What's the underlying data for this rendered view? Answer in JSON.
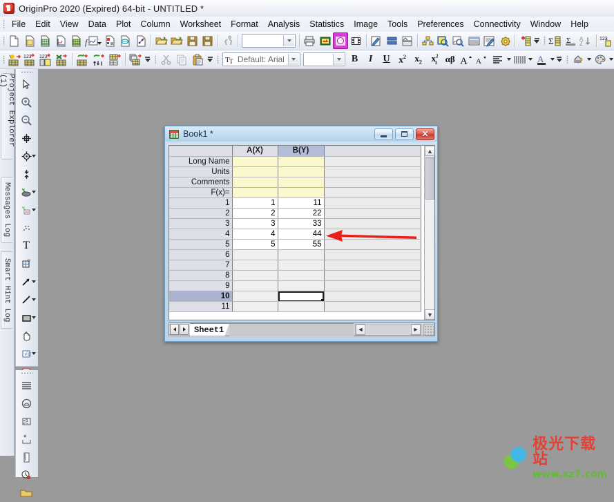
{
  "window": {
    "title": "OriginPro 2020 (Expired) 64-bit - UNTITLED *",
    "app_icon": "origin-app-icon"
  },
  "menubar": {
    "items": [
      {
        "label": "File"
      },
      {
        "label": "Edit"
      },
      {
        "label": "View"
      },
      {
        "label": "Data"
      },
      {
        "label": "Plot"
      },
      {
        "label": "Column"
      },
      {
        "label": "Worksheet"
      },
      {
        "label": "Format"
      },
      {
        "label": "Analysis"
      },
      {
        "label": "Statistics"
      },
      {
        "label": "Image"
      },
      {
        "label": "Tools"
      },
      {
        "label": "Preferences"
      },
      {
        "label": "Connectivity"
      },
      {
        "label": "Window"
      },
      {
        "label": "Help"
      }
    ]
  },
  "toolbar_standard": {
    "buttons": [
      {
        "name": "new-project-icon"
      },
      {
        "name": "new-folder-icon"
      },
      {
        "name": "new-workbook-icon"
      },
      {
        "name": "new-graph-icon"
      },
      {
        "name": "new-function-plot-icon"
      },
      {
        "name": "new-matrix-icon"
      },
      {
        "name": "new-layout-icon"
      },
      {
        "name": "new-notes-icon"
      },
      {
        "name": "open-project-icon"
      },
      {
        "name": "open-template-icon"
      },
      {
        "name": "save-project-icon"
      },
      {
        "name": "save-template-icon"
      },
      {
        "name": "run-script-icon"
      },
      {
        "name": "print-icon"
      },
      {
        "name": "print-preview-icon"
      },
      {
        "name": "export-graph-icon"
      },
      {
        "name": "movie-icon"
      },
      {
        "name": "send-graph-icon"
      },
      {
        "name": "duplicate-icon"
      },
      {
        "name": "merge-graph-icon"
      },
      {
        "name": "project-explorer-icon"
      },
      {
        "name": "results-log-icon"
      },
      {
        "name": "command-window-icon"
      },
      {
        "name": "code-builder-icon"
      },
      {
        "name": "script-window-icon"
      },
      {
        "name": "app-gallery-icon"
      },
      {
        "name": "add-new-column-icon"
      },
      {
        "name": "statistics-on-columns-icon"
      },
      {
        "name": "sum-icon"
      },
      {
        "name": "sort-az-icon"
      },
      {
        "name": "sort-numeric-icon"
      }
    ],
    "layer_combo": {
      "value": "",
      "placeholder": ""
    }
  },
  "toolbar_format": {
    "buttons": [
      {
        "name": "set-column-values-icon"
      },
      {
        "name": "fill-row-numbers-icon"
      },
      {
        "name": "normalize-columns-icon"
      },
      {
        "name": "transpose-icon"
      },
      {
        "name": "swap-columns-icon"
      },
      {
        "name": "stack-columns-icon"
      },
      {
        "name": "reduce-rows-icon"
      },
      {
        "name": "copy-columns-icon"
      },
      {
        "name": "cut-icon"
      },
      {
        "name": "copy-icon"
      },
      {
        "name": "paste-icon"
      },
      {
        "name": "bold-icon"
      },
      {
        "name": "italic-icon"
      },
      {
        "name": "underline-icon"
      },
      {
        "name": "superscript-icon"
      },
      {
        "name": "subscript-icon"
      },
      {
        "name": "sub-superscript-icon"
      },
      {
        "name": "greek-icon"
      },
      {
        "name": "increase-font-icon"
      },
      {
        "name": "decrease-font-icon"
      },
      {
        "name": "align-icon"
      },
      {
        "name": "line-style-icon"
      },
      {
        "name": "font-color-icon"
      },
      {
        "name": "fill-color-icon"
      },
      {
        "name": "palette-icon"
      }
    ],
    "font_combo": {
      "value": "Default: Arial",
      "icon": "font-icon"
    },
    "size_combo": {
      "value": ""
    }
  },
  "left_dock": {
    "tabs": [
      {
        "label": "Project Explorer (1)",
        "name": "project-explorer-tab"
      },
      {
        "label": "Messages Log",
        "name": "messages-log-tab"
      },
      {
        "label": "Smart Hint Log",
        "name": "smart-hint-log-tab"
      }
    ]
  },
  "tools_palette": {
    "tools": [
      {
        "name": "pointer-tool-icon"
      },
      {
        "name": "zoom-in-tool-icon"
      },
      {
        "name": "zoom-out-tool-icon"
      },
      {
        "name": "screen-reader-tool-icon"
      },
      {
        "name": "data-reader-tool-icon"
      },
      {
        "name": "data-selector-tool-icon"
      },
      {
        "name": "regional-mask-tool-icon"
      },
      {
        "name": "regional-data-select-tool-icon"
      },
      {
        "name": "draw-data-tool-icon"
      },
      {
        "name": "text-tool-icon"
      },
      {
        "name": "object-edit-tool-icon"
      },
      {
        "name": "arrow-tool-icon"
      },
      {
        "name": "line-tool-icon"
      },
      {
        "name": "rectangle-tool-icon"
      },
      {
        "name": "scale-in-tool-icon"
      },
      {
        "name": "equation-tool-icon"
      },
      {
        "name": "region-graph-tool-icon"
      },
      {
        "name": "scale-out-tool-icon"
      },
      {
        "name": "layer-tool-icon"
      }
    ],
    "tools2": [
      {
        "name": "lines-icon"
      },
      {
        "name": "round-icon"
      },
      {
        "name": "replace-icon"
      },
      {
        "name": "asterisk-icon"
      },
      {
        "name": "ruler-icon"
      },
      {
        "name": "timestamp-icon"
      },
      {
        "name": "folder-icon"
      }
    ]
  },
  "workbook": {
    "title": "Book1 *",
    "icon": "workbook-icon",
    "controls": {
      "minimize": "minimize-button",
      "restore": "restore-button",
      "close": "close-button"
    },
    "columns": [
      {
        "label": "",
        "name": "row-header-column",
        "selected": false
      },
      {
        "label": "A(X)",
        "name": "column-a",
        "selected": false
      },
      {
        "label": "B(Y)",
        "name": "column-b",
        "selected": true
      }
    ],
    "meta_rows": [
      {
        "label": "Long Name",
        "a": "",
        "b": ""
      },
      {
        "label": "Units",
        "a": "",
        "b": ""
      },
      {
        "label": "Comments",
        "a": "",
        "b": ""
      },
      {
        "label": "F(x)=",
        "a": "",
        "b": ""
      }
    ],
    "data_rows": [
      {
        "n": "1",
        "a": "1",
        "b": "11",
        "empty": false,
        "selected": false
      },
      {
        "n": "2",
        "a": "2",
        "b": "22",
        "empty": false,
        "selected": false
      },
      {
        "n": "3",
        "a": "3",
        "b": "33",
        "empty": false,
        "selected": false
      },
      {
        "n": "4",
        "a": "4",
        "b": "44",
        "empty": false,
        "selected": false
      },
      {
        "n": "5",
        "a": "5",
        "b": "55",
        "empty": false,
        "selected": false
      },
      {
        "n": "6",
        "a": "",
        "b": "",
        "empty": true,
        "selected": false
      },
      {
        "n": "7",
        "a": "",
        "b": "",
        "empty": true,
        "selected": false
      },
      {
        "n": "8",
        "a": "",
        "b": "",
        "empty": true,
        "selected": false
      },
      {
        "n": "9",
        "a": "",
        "b": "",
        "empty": true,
        "selected": false
      },
      {
        "n": "10",
        "a": "",
        "b": "",
        "empty": true,
        "selected": true
      },
      {
        "n": "11",
        "a": "",
        "b": "",
        "empty": true,
        "selected": false
      }
    ],
    "active_cell": "B10",
    "sheet_tab": "Sheet1",
    "nav": {
      "prev": "prev-sheet-button",
      "next": "next-sheet-button"
    }
  },
  "annotation": {
    "arrow": {
      "name": "red-arrow-annotation",
      "color": "#e8201a",
      "direction": "left"
    }
  },
  "watermark": {
    "site_cn": "极光下载站",
    "site_url": "www.xz7.com"
  }
}
